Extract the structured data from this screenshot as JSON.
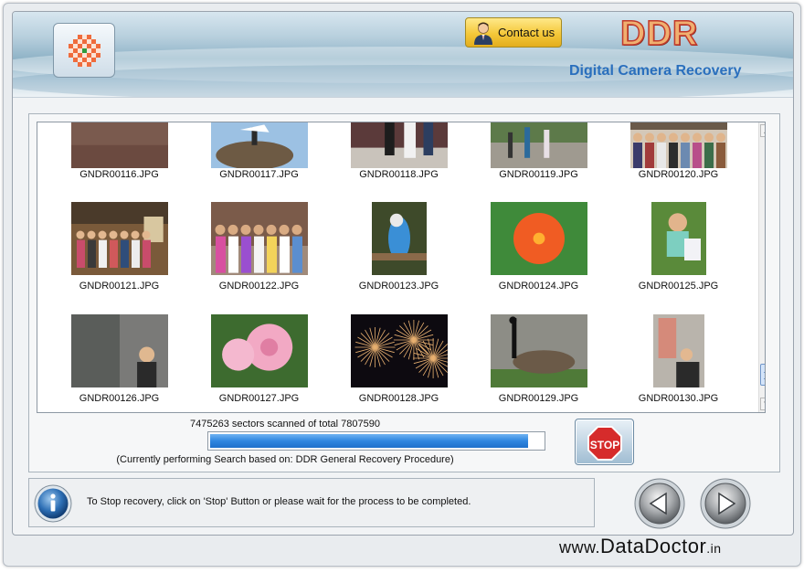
{
  "header": {
    "brand": "DDR",
    "subtitle": "Digital Camera Recovery",
    "contact_label": "Contact us"
  },
  "thumbnails": [
    {
      "name": "GNDR00116.JPG",
      "scene": "field"
    },
    {
      "name": "GNDR00117.JPG",
      "scene": "nest"
    },
    {
      "name": "GNDR00118.JPG",
      "scene": "party"
    },
    {
      "name": "GNDR00119.JPG",
      "scene": "walk"
    },
    {
      "name": "GNDR00120.JPG",
      "scene": "crowd"
    },
    {
      "name": "GNDR00121.JPG",
      "scene": "hall"
    },
    {
      "name": "GNDR00122.JPG",
      "scene": "family"
    },
    {
      "name": "GNDR00123.JPG",
      "scene": "bird"
    },
    {
      "name": "GNDR00124.JPG",
      "scene": "flower"
    },
    {
      "name": "GNDR00125.JPG",
      "scene": "child"
    },
    {
      "name": "GNDR00126.JPG",
      "scene": "statue"
    },
    {
      "name": "GNDR00127.JPG",
      "scene": "rose"
    },
    {
      "name": "GNDR00128.JPG",
      "scene": "fireworks"
    },
    {
      "name": "GNDR00129.JPG",
      "scene": "goose"
    },
    {
      "name": "GNDR00130.JPG",
      "scene": "portrait"
    }
  ],
  "scan": {
    "status": "7475263 sectors scanned of total 7807590",
    "progress_fraction": 0.957,
    "note": "(Currently performing Search based on:  DDR General Recovery Procedure)",
    "stop_label": "STOP"
  },
  "info": {
    "message": "To Stop recovery, click on 'Stop' Button or please wait for the process to be completed."
  },
  "footer": {
    "www": "www.",
    "site": "DataDoctor",
    "tld": ".in"
  },
  "colors": {
    "subtitle": "#2a6fbd",
    "progress": "#2f86e0",
    "stop": "#d62b2b",
    "contact": "#f4c83a"
  }
}
